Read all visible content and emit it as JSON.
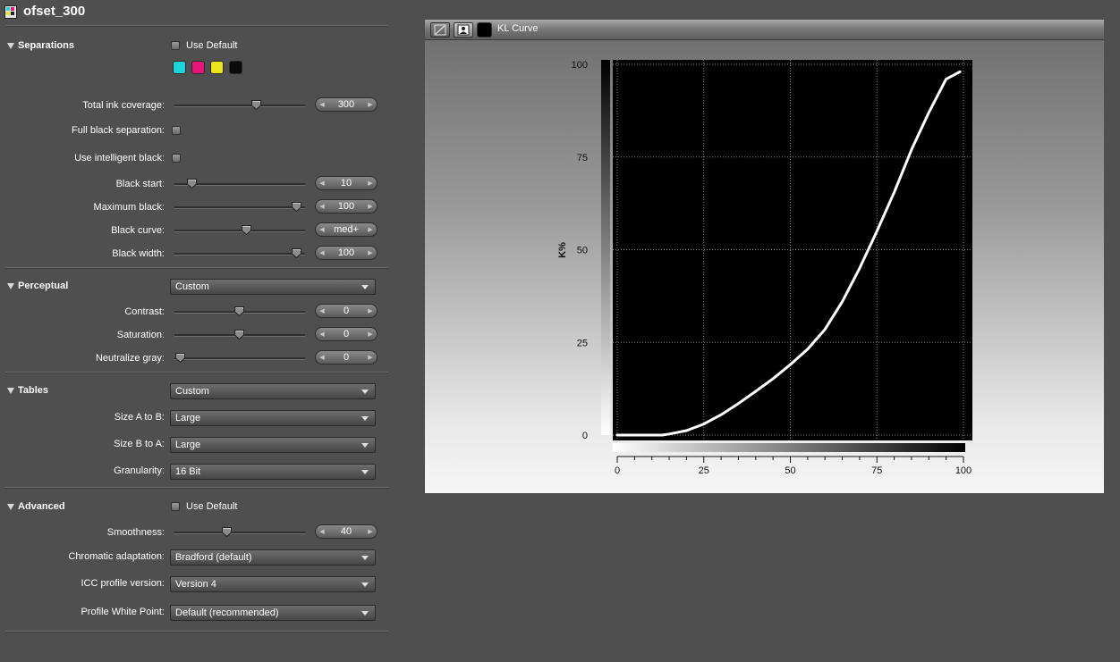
{
  "title": "ofset_300",
  "separations": {
    "header": "Separations",
    "use_default": "Use Default",
    "swatches": [
      "#1fd3dc",
      "#e8147a",
      "#ece51a",
      "#0a0a0a"
    ],
    "total_ink_coverage": {
      "label": "Total ink coverage:",
      "value": "300",
      "level": 0.62
    },
    "full_black_separation": {
      "label": "Full black separation:"
    },
    "use_intelligent_black": {
      "label": "Use intelligent black:"
    },
    "black_start": {
      "label": "Black start:",
      "value": "10",
      "level": 0.13
    },
    "maximum_black": {
      "label": "Maximum black:",
      "value": "100",
      "level": 0.93
    },
    "black_curve": {
      "label": "Black curve:",
      "value": "med+",
      "level": 0.55
    },
    "black_width": {
      "label": "Black width:",
      "value": "100",
      "level": 0.93
    }
  },
  "perceptual": {
    "header": "Perceptual",
    "preset": "Custom",
    "contrast": {
      "label": "Contrast:",
      "value": "0",
      "level": 0.49
    },
    "saturation": {
      "label": "Saturation:",
      "value": "0",
      "level": 0.49
    },
    "neutralize_gray": {
      "label": "Neutralize gray:",
      "value": "0",
      "level": 0.04
    }
  },
  "tables": {
    "header": "Tables",
    "preset": "Custom",
    "size_a_to_b": {
      "label": "Size A to B:",
      "value": "Large"
    },
    "size_b_to_a": {
      "label": "Size B to A:",
      "value": "Large"
    },
    "granularity": {
      "label": "Granularity:",
      "value": "16 Bit"
    }
  },
  "advanced": {
    "header": "Advanced",
    "use_default": "Use Default",
    "smoothness": {
      "label": "Smoothness:",
      "value": "40",
      "level": 0.4
    },
    "chromatic_adaptation": {
      "label": "Chromatic adaptation:",
      "value": "Bradford (default)"
    },
    "icc_profile_version": {
      "label": "ICC profile version:",
      "value": "Version 4"
    },
    "profile_white_point": {
      "label": "Profile White Point:",
      "value": "Default (recommended)"
    }
  },
  "graph": {
    "toolbar_label": "KL Curve"
  },
  "chart_data": {
    "type": "line",
    "title": "",
    "xlabel": "",
    "ylabel": "K%",
    "xlim": [
      0,
      100
    ],
    "ylim": [
      0,
      100
    ],
    "xticks": [
      0,
      25,
      50,
      75,
      100
    ],
    "yticks": [
      0,
      25,
      50,
      75,
      100
    ],
    "grid": true,
    "series": [
      {
        "values_x": [
          0,
          5,
          10,
          13,
          15,
          20,
          25,
          30,
          35,
          40,
          45,
          50,
          55,
          60,
          65,
          70,
          75,
          80,
          85,
          90,
          95,
          99
        ],
        "values_y": [
          0,
          0,
          0,
          0,
          0.3,
          1.2,
          3,
          5.5,
          8.5,
          11.8,
          15.2,
          19,
          23.2,
          28.5,
          36,
          45,
          55,
          65.5,
          77,
          87,
          96,
          98
        ]
      }
    ],
    "colors": {
      "plot_bg": "#000000",
      "line": "#ffffff",
      "grid": "#8a8a8a"
    }
  }
}
